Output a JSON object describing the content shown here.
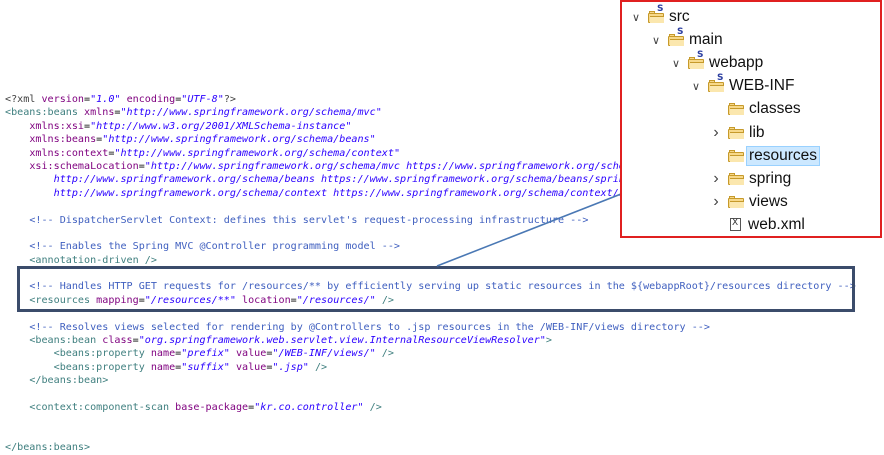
{
  "editor": {
    "lines": [
      {
        "parts": [
          {
            "t": "pi",
            "s": "<?xml "
          },
          {
            "t": "attr",
            "s": "version"
          },
          {
            "t": "plain",
            "s": "="
          },
          {
            "t": "val",
            "s": "\"1.0\""
          },
          {
            "t": "plain",
            "s": " "
          },
          {
            "t": "attr",
            "s": "encoding"
          },
          {
            "t": "plain",
            "s": "="
          },
          {
            "t": "val",
            "s": "\"UTF-8\""
          },
          {
            "t": "pi",
            "s": "?>"
          }
        ]
      },
      {
        "parts": [
          {
            "t": "tag",
            "s": "<beans:beans "
          },
          {
            "t": "attr",
            "s": "xmlns"
          },
          {
            "t": "plain",
            "s": "="
          },
          {
            "t": "val",
            "s": "\"http://www.springframework.org/schema/mvc\""
          }
        ]
      },
      {
        "parts": [
          {
            "t": "plain",
            "s": "    "
          },
          {
            "t": "attr",
            "s": "xmlns:xsi"
          },
          {
            "t": "plain",
            "s": "="
          },
          {
            "t": "val",
            "s": "\"http://www.w3.org/2001/XMLSchema-instance\""
          }
        ]
      },
      {
        "parts": [
          {
            "t": "plain",
            "s": "    "
          },
          {
            "t": "attr",
            "s": "xmlns:beans"
          },
          {
            "t": "plain",
            "s": "="
          },
          {
            "t": "val",
            "s": "\"http://www.springframework.org/schema/beans\""
          }
        ]
      },
      {
        "parts": [
          {
            "t": "plain",
            "s": "    "
          },
          {
            "t": "attr",
            "s": "xmlns:context"
          },
          {
            "t": "plain",
            "s": "="
          },
          {
            "t": "val",
            "s": "\"http://www.springframework.org/schema/context\""
          }
        ]
      },
      {
        "parts": [
          {
            "t": "plain",
            "s": "    "
          },
          {
            "t": "attr",
            "s": "xsi:schemaLocation"
          },
          {
            "t": "plain",
            "s": "="
          },
          {
            "t": "val",
            "s": "\"http://www.springframework.org/schema/mvc https://www.springframework.org/schema/mvc/spring-mvc.xsd"
          }
        ]
      },
      {
        "parts": [
          {
            "t": "val",
            "s": "        http://www.springframework.org/schema/beans https://www.springframework.org/schema/beans/spring-beans.xsd"
          }
        ]
      },
      {
        "parts": [
          {
            "t": "val",
            "s": "        http://www.springframework.org/schema/context https://www.springframework.org/schema/context/spring-context.xsd\""
          },
          {
            "t": "tag",
            "s": ">"
          }
        ]
      },
      {
        "parts": []
      },
      {
        "parts": [
          {
            "t": "plain",
            "s": "    "
          },
          {
            "t": "comment",
            "s": "<!-- DispatcherServlet Context: defines this servlet's request-processing infrastructure -->"
          }
        ]
      },
      {
        "parts": []
      },
      {
        "parts": [
          {
            "t": "plain",
            "s": "    "
          },
          {
            "t": "comment",
            "s": "<!-- Enables the Spring MVC @Controller programming model -->"
          }
        ]
      },
      {
        "parts": [
          {
            "t": "plain",
            "s": "    "
          },
          {
            "t": "tag",
            "s": "<annotation-driven />"
          }
        ]
      },
      {
        "parts": []
      },
      {
        "parts": [
          {
            "t": "plain",
            "s": "    "
          },
          {
            "t": "comment",
            "s": "<!-- Handles HTTP GET requests for /resources/** by efficiently serving up static resources in the ${webappRoot}/resources directory -->"
          }
        ]
      },
      {
        "parts": [
          {
            "t": "plain",
            "s": "    "
          },
          {
            "t": "tag",
            "s": "<resources "
          },
          {
            "t": "attr",
            "s": "mapping"
          },
          {
            "t": "plain",
            "s": "="
          },
          {
            "t": "val",
            "s": "\"/resources/**\""
          },
          {
            "t": "plain",
            "s": " "
          },
          {
            "t": "attr",
            "s": "location"
          },
          {
            "t": "plain",
            "s": "="
          },
          {
            "t": "val",
            "s": "\"/resources/\""
          },
          {
            "t": "tag",
            "s": " />"
          }
        ]
      },
      {
        "parts": []
      },
      {
        "parts": [
          {
            "t": "plain",
            "s": "    "
          },
          {
            "t": "comment",
            "s": "<!-- Resolves views selected for rendering by @Controllers to .jsp resources in the /WEB-INF/views directory -->"
          }
        ]
      },
      {
        "parts": [
          {
            "t": "plain",
            "s": "    "
          },
          {
            "t": "tag",
            "s": "<beans:bean "
          },
          {
            "t": "attr",
            "s": "class"
          },
          {
            "t": "plain",
            "s": "="
          },
          {
            "t": "val",
            "s": "\"org.springframework.web.servlet.view.InternalResourceViewResolver\""
          },
          {
            "t": "tag",
            "s": ">"
          }
        ]
      },
      {
        "parts": [
          {
            "t": "plain",
            "s": "        "
          },
          {
            "t": "tag",
            "s": "<beans:property "
          },
          {
            "t": "attr",
            "s": "name"
          },
          {
            "t": "plain",
            "s": "="
          },
          {
            "t": "val",
            "s": "\"prefix\""
          },
          {
            "t": "plain",
            "s": " "
          },
          {
            "t": "attr",
            "s": "value"
          },
          {
            "t": "plain",
            "s": "="
          },
          {
            "t": "val",
            "s": "\"/WEB-INF/views/\""
          },
          {
            "t": "tag",
            "s": " />"
          }
        ]
      },
      {
        "parts": [
          {
            "t": "plain",
            "s": "        "
          },
          {
            "t": "tag",
            "s": "<beans:property "
          },
          {
            "t": "attr",
            "s": "name"
          },
          {
            "t": "plain",
            "s": "="
          },
          {
            "t": "val",
            "s": "\"suffix\""
          },
          {
            "t": "plain",
            "s": " "
          },
          {
            "t": "attr",
            "s": "value"
          },
          {
            "t": "plain",
            "s": "="
          },
          {
            "t": "val",
            "s": "\".jsp\""
          },
          {
            "t": "tag",
            "s": " />"
          }
        ]
      },
      {
        "parts": [
          {
            "t": "plain",
            "s": "    "
          },
          {
            "t": "tag",
            "s": "</beans:bean>"
          }
        ]
      },
      {
        "parts": []
      },
      {
        "parts": [
          {
            "t": "plain",
            "s": "    "
          },
          {
            "t": "tag",
            "s": "<context:component-scan "
          },
          {
            "t": "attr",
            "s": "base-package"
          },
          {
            "t": "plain",
            "s": "="
          },
          {
            "t": "val",
            "s": "\"kr.co.controller\""
          },
          {
            "t": "tag",
            "s": " />"
          }
        ]
      },
      {
        "parts": []
      },
      {
        "parts": []
      },
      {
        "parts": [
          {
            "t": "tag",
            "s": "</beans:beans>"
          }
        ]
      }
    ]
  },
  "tree": {
    "items": [
      {
        "label": "src",
        "depth": 0,
        "kind": "source-folder",
        "chevron": "expanded"
      },
      {
        "label": "main",
        "depth": 1,
        "kind": "source-folder",
        "chevron": "expanded"
      },
      {
        "label": "webapp",
        "depth": 2,
        "kind": "source-folder",
        "chevron": "expanded"
      },
      {
        "label": "WEB-INF",
        "depth": 3,
        "kind": "source-folder",
        "chevron": "expanded"
      },
      {
        "label": "classes",
        "depth": 4,
        "kind": "folder",
        "chevron": "none"
      },
      {
        "label": "lib",
        "depth": 4,
        "kind": "folder",
        "chevron": "collapsed"
      },
      {
        "label": "resources",
        "depth": 4,
        "kind": "folder",
        "chevron": "none",
        "selected": true
      },
      {
        "label": "spring",
        "depth": 4,
        "kind": "folder",
        "chevron": "collapsed"
      },
      {
        "label": "views",
        "depth": 4,
        "kind": "folder",
        "chevron": "collapsed"
      },
      {
        "label": "web.xml",
        "depth": 4,
        "kind": "file",
        "chevron": "none"
      }
    ]
  },
  "colors": {
    "tree_border": "#e02020",
    "highlight_border": "#3b4c6b",
    "arrow": "#4a78b4",
    "selection": "#cce8ff"
  }
}
